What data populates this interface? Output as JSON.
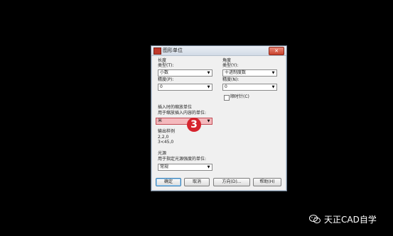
{
  "dialog": {
    "title": "图形单位",
    "close_glyph": "✕"
  },
  "length": {
    "group_label": "长度",
    "type_label": "类型(T):",
    "type_value": "小数",
    "precision_label": "精度(P):",
    "precision_value": "0"
  },
  "angle": {
    "group_label": "角度",
    "type_label": "类型(Y):",
    "type_value": "十进制度数",
    "precision_label": "精度(N):",
    "precision_value": "0",
    "clockwise_label": "顺时针(C)"
  },
  "insertion": {
    "group_label": "插入时的缩放单位",
    "description": "用于缩放插入内容的单位:",
    "value": "米",
    "step_badge": "3"
  },
  "output": {
    "group_label": "输出样例",
    "line1": "2,2,0",
    "line2": "3<45,0"
  },
  "lighting": {
    "group_label": "光源",
    "description": "用于指定光源强度的单位:",
    "value": "常规"
  },
  "buttons": {
    "ok": "确定",
    "cancel": "取消",
    "direction": "方向(D)...",
    "help": "帮助(H)"
  },
  "watermark": {
    "text": "天正CAD自学"
  },
  "colors": {
    "highlight": "#f4b9bd",
    "badge": "#d6232d"
  }
}
